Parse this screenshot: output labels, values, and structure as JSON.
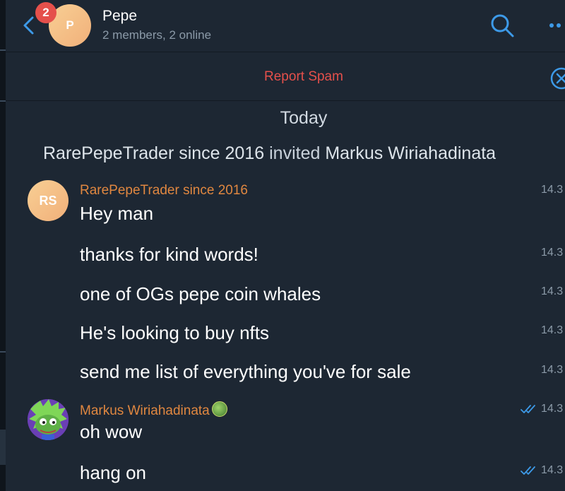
{
  "header": {
    "unread_count": "2",
    "avatar_initial": "P",
    "title": "Pepe",
    "subtitle": "2 members, 2 online"
  },
  "spam_bar": {
    "label": "Report Spam"
  },
  "chat": {
    "date_label": "Today",
    "service_message": {
      "actor": "RarePepeTrader since 2016",
      "action": "invited",
      "target": "Markus Wiriahadinata"
    },
    "groups": [
      {
        "sender": "RarePepeTrader since 2016",
        "avatar_initials": "RS",
        "messages": [
          {
            "text": "Hey man",
            "time": "14.3"
          },
          {
            "text": "thanks for kind words!",
            "time": "14.3"
          },
          {
            "text": "one of OGs pepe coin whales",
            "time": "14.3"
          },
          {
            "text": "He's looking to buy nfts",
            "time": "14.3"
          },
          {
            "text": "send me list of everything you've for sale",
            "time": "14.3"
          }
        ]
      },
      {
        "sender": "Markus Wiriahadinata",
        "messages": [
          {
            "text": "oh wow",
            "time": "14.3",
            "status": "read"
          },
          {
            "text": "hang on",
            "time": "14.3",
            "status": "read"
          }
        ]
      }
    ]
  },
  "colors": {
    "background": "#1d2733",
    "accent": "#3d9ae8",
    "sender_name": "#e08740",
    "spam": "#e5504b",
    "badge": "#e5504b"
  }
}
